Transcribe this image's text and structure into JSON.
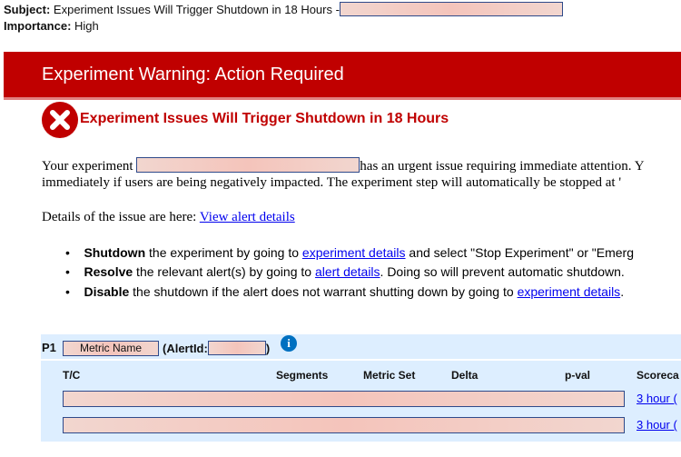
{
  "email": {
    "subject_label": "Subject:",
    "subject": "Experiment Issues Will Trigger Shutdown in 18 Hours -",
    "importance_label": "Importance:",
    "importance": "High"
  },
  "banner": {
    "title": "Experiment Warning: Action Required",
    "color": "#c00000"
  },
  "alert": {
    "icon": "error-x-icon",
    "title": "Experiment Issues Will Trigger Shutdown in 18 Hours"
  },
  "body": {
    "line1_a": "Your experiment",
    "line1_b": "has an urgent issue requiring immediate attention. Y",
    "line2": "immediately if users are being negatively impacted. The experiment step will automatically be stopped at '",
    "details_text": "Details of the issue are here:",
    "details_link": "View alert details"
  },
  "bullets": [
    {
      "bold": "Shutdown",
      "text": " the experiment by going to ",
      "link": "experiment details",
      "after": " and select \"Stop Experiment\" or \"Emerg"
    },
    {
      "bold": "Resolve",
      "text": " the relevant alert(s) by going to ",
      "link": "alert details",
      "after": ". Doing so will prevent automatic shutdown."
    },
    {
      "bold": "Disable",
      "text": " the shutdown if the alert does not warrant shutting down by going to ",
      "link": "experiment details",
      "after": "."
    }
  ],
  "table": {
    "priority": "P1",
    "metric_name": "Metric Name",
    "alert_id_label": "(AlertId:",
    "alert_id_close": ")",
    "info_icon": "info-icon",
    "columns": [
      "T/C",
      "Segments",
      "Metric Set",
      "Delta",
      "p-val",
      "Scoreca"
    ],
    "rows": [
      {
        "link": "3 hour ("
      },
      {
        "link": "3 hour ("
      }
    ]
  }
}
